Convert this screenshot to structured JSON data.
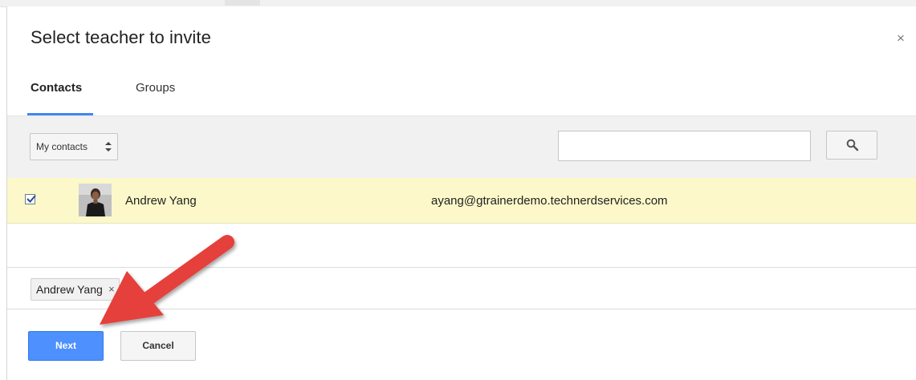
{
  "dialog": {
    "title": "Select teacher to invite",
    "close_label": "×"
  },
  "tabs": [
    {
      "label": "Contacts",
      "active": true
    },
    {
      "label": "Groups",
      "active": false
    }
  ],
  "toolbar": {
    "contacts_select": {
      "selected": "My contacts",
      "icon": "up-down-arrows-icon"
    },
    "search": {
      "value": "",
      "placeholder": "",
      "button_icon": "search-icon"
    }
  },
  "results": [
    {
      "checked": true,
      "name": "Andrew Yang",
      "email": "ayang@gtrainerdemo.technerdservices.com",
      "highlight_color": "#fcf8c9"
    }
  ],
  "selected_chips": [
    {
      "label": "Andrew Yang",
      "remove_label": "×"
    }
  ],
  "footer": {
    "next_label": "Next",
    "cancel_label": "Cancel"
  },
  "colors": {
    "primary_button": "#4d90fe",
    "tab_underline": "#4285f4",
    "annotation_arrow": "#e5413b"
  }
}
